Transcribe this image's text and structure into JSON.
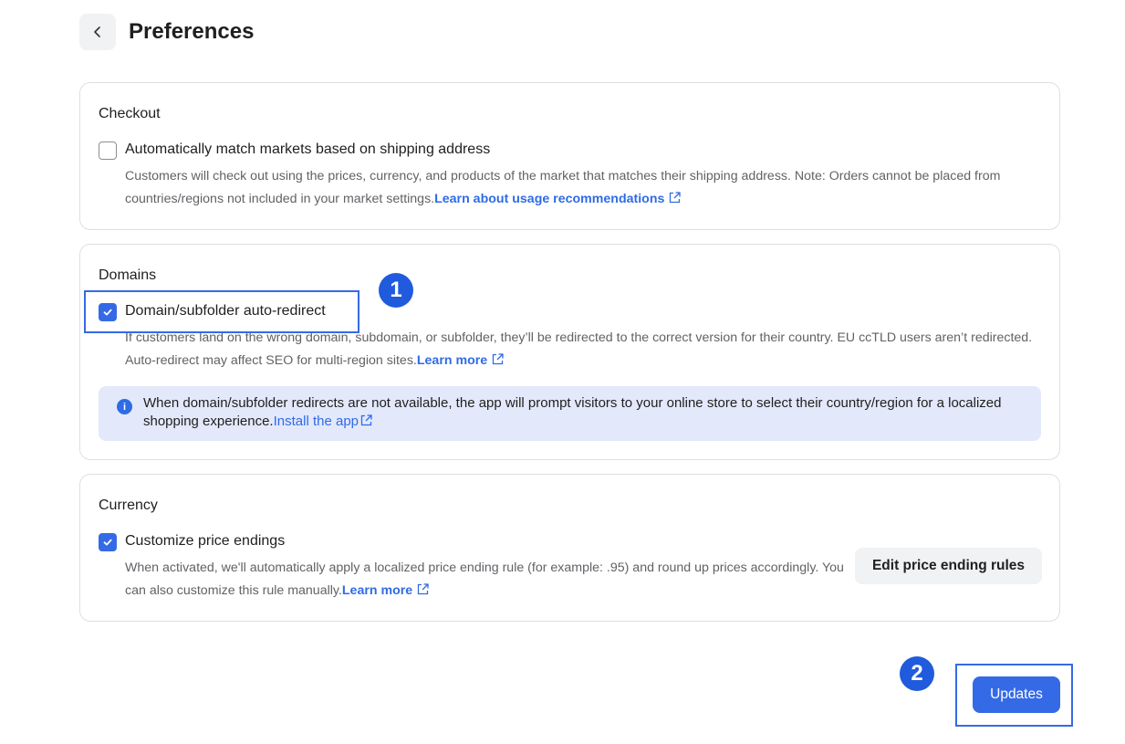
{
  "header": {
    "title": "Preferences",
    "back_icon": "chevron-left-icon"
  },
  "checkout": {
    "title": "Checkout",
    "option_label": "Automatically match markets based on shipping address",
    "checked": false,
    "description": "Customers will check out using the prices, currency, and products of the market that matches their shipping address. Note: Orders cannot be placed from countries/regions not included in your market settings.",
    "link": "Learn about usage recommendations"
  },
  "domains": {
    "title": "Domains",
    "option_label": "Domain/subfolder auto-redirect",
    "checked": true,
    "description": "If customers land on the wrong domain, subdomain, or subfolder, they’ll be redirected to the correct version for their country. EU ccTLD users aren’t redirected. Auto-redirect may affect SEO for multi-region sites.",
    "link": "Learn more",
    "info_text": "When domain/subfolder redirects are not available, the app will prompt visitors to your online store to select their country/region for a localized shopping experience.",
    "info_link": "Install the app"
  },
  "currency": {
    "title": "Currency",
    "option_label": "Customize price endings",
    "checked": true,
    "description": "When activated, we'll automatically apply a localized price ending rule (for example: .95) and round up prices accordingly. You can also customize this rule manually.",
    "link": "Learn more",
    "edit_button": "Edit price ending rules"
  },
  "annotations": {
    "badge_1": "1",
    "badge_2": "2"
  },
  "footer": {
    "update_button": "Updates"
  },
  "colors": {
    "accent": "#356ae6",
    "badge": "#1f5bdc",
    "info_bg": "#e3e9fb"
  }
}
